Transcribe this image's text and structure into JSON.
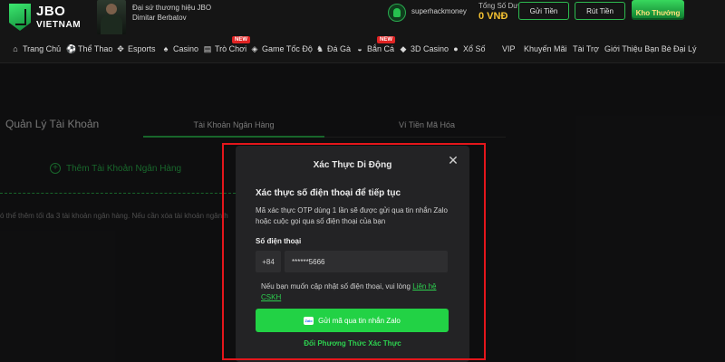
{
  "header": {
    "logo_line1": "JBO",
    "logo_line2": "VIETNAM",
    "ambassador_title": "Đại sứ thương hiệu JBO",
    "ambassador_name": "Dimitar Berbatov",
    "username": "superhackmoney",
    "balance_label": "Tổng Số Dư",
    "balance_value": "0 VNĐ",
    "deposit_label": "Gửi Tiền",
    "withdraw_label": "Rút Tiền",
    "reward_label": "Kho Thưởng"
  },
  "nav": {
    "items": [
      {
        "label": "Trang Chủ",
        "icon": "home-icon"
      },
      {
        "label": "Thể Thao",
        "icon": "soccer-ball-icon"
      },
      {
        "label": "Esports",
        "icon": "gamepad-icon"
      },
      {
        "label": "Casino",
        "icon": "spade-icon"
      },
      {
        "label": "Trò Chơi",
        "icon": "slot-icon",
        "badge": "NEW"
      },
      {
        "label": "Game Tốc Độ",
        "icon": "controller-icon"
      },
      {
        "label": "Đá Gà",
        "icon": "rooster-icon"
      },
      {
        "label": "Bắn Cá",
        "icon": "fish-icon",
        "badge": "NEW"
      },
      {
        "label": "3D Casino",
        "icon": "cube-icon"
      },
      {
        "label": "Xổ Số",
        "icon": "lottery-ball-icon"
      },
      {
        "label": "VIP"
      },
      {
        "label": "Khuyến Mãi"
      },
      {
        "label": "Tài Trợ"
      },
      {
        "label": "Giới Thiệu Bạn Bè"
      },
      {
        "label": "Đại Lý"
      }
    ]
  },
  "account": {
    "title": "Quản Lý Tài Khoản",
    "tab_bank": "Tài Khoản Ngân Hàng",
    "tab_crypto": "Ví Tiền Mã Hóa",
    "add_bank": "Thêm Tài Khoản Ngân Hàng",
    "note": "ó thể thêm tối đa 3 tài khoản ngân hàng. Nếu cần xóa tài khoản ngân h"
  },
  "modal": {
    "title": "Xác Thực Di Động",
    "subtitle": "Xác thực số điện thoại để tiếp tục",
    "description": "Mã xác thực OTP dùng 1 lần sẽ được gửi qua tin nhắn Zalo hoặc cuộc gọi qua số điện thoại của bạn",
    "phone_label": "Số điện thoại",
    "country_code": "+84",
    "phone_value": "******5666",
    "help_text": "Nếu bạn muốn cập nhật số điện thoại, vui lòng ",
    "help_link": "Liên hệ CSKH",
    "zalo_icon_text": "Zalo",
    "zalo_button": "Gửi mã qua tin nhắn Zalo",
    "alt_method": "Đổi Phương Thức Xác Thực",
    "close_symbol": "✕"
  },
  "colors": {
    "accent_green": "#22d245",
    "highlight_red": "#e4161b",
    "balance_gold": "#f5c232",
    "new_badge": "#e02424"
  }
}
